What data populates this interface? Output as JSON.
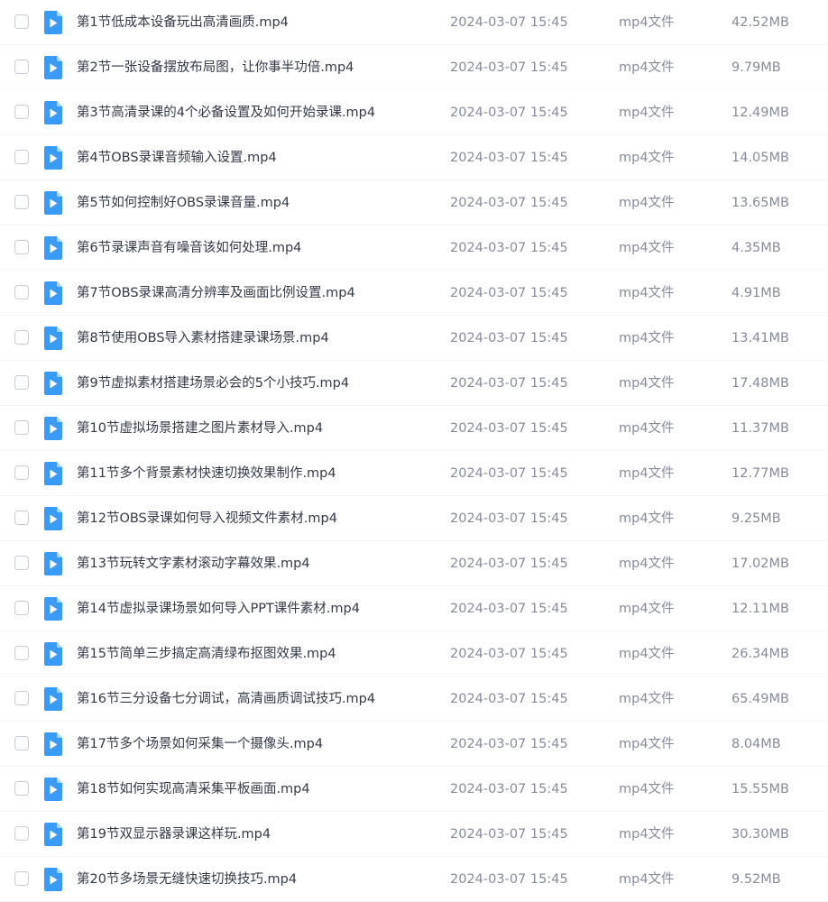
{
  "file_list": {
    "icon": "video-file-icon",
    "colors": {
      "icon_blue": "#3a9bf7",
      "icon_fold": "#a9d2fb",
      "name_text": "#333a48",
      "meta_text": "#878c9c"
    },
    "rows": [
      {
        "name": "第1节低成本设备玩出高清画质.mp4",
        "date": "2024-03-07 15:45",
        "type": "mp4文件",
        "size": "42.52MB"
      },
      {
        "name": "第2节一张设备摆放布局图，让你事半功倍.mp4",
        "date": "2024-03-07 15:45",
        "type": "mp4文件",
        "size": "9.79MB"
      },
      {
        "name": "第3节高清录课的4个必备设置及如何开始录课.mp4",
        "date": "2024-03-07 15:45",
        "type": "mp4文件",
        "size": "12.49MB"
      },
      {
        "name": "第4节OBS录课音频输入设置.mp4",
        "date": "2024-03-07 15:45",
        "type": "mp4文件",
        "size": "14.05MB"
      },
      {
        "name": "第5节如何控制好OBS录课音量.mp4",
        "date": "2024-03-07 15:45",
        "type": "mp4文件",
        "size": "13.65MB"
      },
      {
        "name": "第6节录课声音有噪音该如何处理.mp4",
        "date": "2024-03-07 15:45",
        "type": "mp4文件",
        "size": "4.35MB"
      },
      {
        "name": "第7节OBS录课高清分辨率及画面比例设置.mp4",
        "date": "2024-03-07 15:45",
        "type": "mp4文件",
        "size": "4.91MB"
      },
      {
        "name": "第8节使用OBS导入素材搭建录课场景.mp4",
        "date": "2024-03-07 15:45",
        "type": "mp4文件",
        "size": "13.41MB"
      },
      {
        "name": "第9节虚拟素材搭建场景必会的5个小技巧.mp4",
        "date": "2024-03-07 15:45",
        "type": "mp4文件",
        "size": "17.48MB"
      },
      {
        "name": "第10节虚拟场景搭建之图片素材导入.mp4",
        "date": "2024-03-07 15:45",
        "type": "mp4文件",
        "size": "11.37MB"
      },
      {
        "name": "第11节多个背景素材快速切换效果制作.mp4",
        "date": "2024-03-07 15:45",
        "type": "mp4文件",
        "size": "12.77MB"
      },
      {
        "name": "第12节OBS录课如何导入视频文件素材.mp4",
        "date": "2024-03-07 15:45",
        "type": "mp4文件",
        "size": "9.25MB"
      },
      {
        "name": "第13节玩转文字素材滚动字幕效果.mp4",
        "date": "2024-03-07 15:45",
        "type": "mp4文件",
        "size": "17.02MB"
      },
      {
        "name": "第14节虚拟录课场景如何导入PPT课件素材.mp4",
        "date": "2024-03-07 15:45",
        "type": "mp4文件",
        "size": "12.11MB"
      },
      {
        "name": "第15节简单三步搞定高清绿布抠图效果.mp4",
        "date": "2024-03-07 15:45",
        "type": "mp4文件",
        "size": "26.34MB"
      },
      {
        "name": "第16节三分设备七分调试，高清画质调试技巧.mp4",
        "date": "2024-03-07 15:45",
        "type": "mp4文件",
        "size": "65.49MB"
      },
      {
        "name": "第17节多个场景如何采集一个摄像头.mp4",
        "date": "2024-03-07 15:45",
        "type": "mp4文件",
        "size": "8.04MB"
      },
      {
        "name": "第18节如何实现高清采集平板画面.mp4",
        "date": "2024-03-07 15:45",
        "type": "mp4文件",
        "size": "15.55MB"
      },
      {
        "name": "第19节双显示器录课这样玩.mp4",
        "date": "2024-03-07 15:45",
        "type": "mp4文件",
        "size": "30.30MB"
      },
      {
        "name": "第20节多场景无缝快速切换技巧.mp4",
        "date": "2024-03-07 15:45",
        "type": "mp4文件",
        "size": "9.52MB"
      }
    ]
  }
}
